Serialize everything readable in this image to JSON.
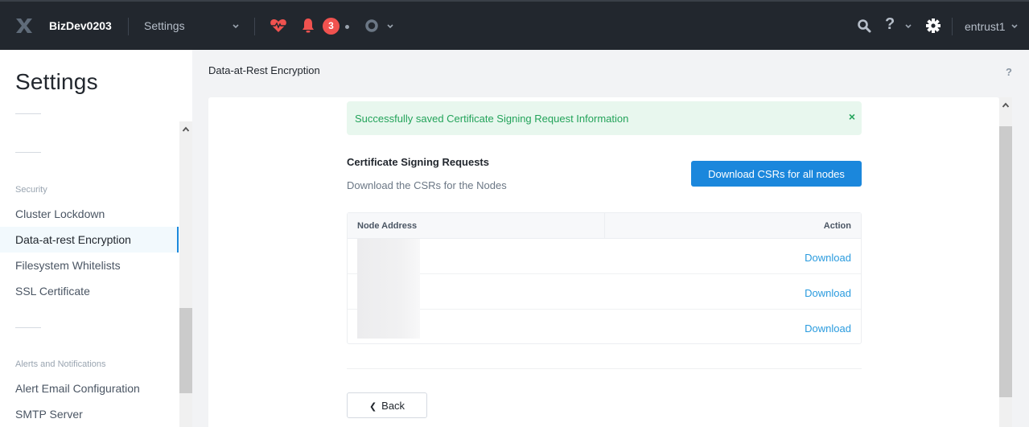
{
  "topbar": {
    "cluster_name": "BizDev0203",
    "app_select": "Settings",
    "alert_count": "3",
    "user_name": "entrust1",
    "icons": [
      "nutanix-logo-icon",
      "chevron-down-icon",
      "health-heart-icon",
      "bell-icon",
      "status-ring-icon",
      "search-icon",
      "help-icon",
      "gear-icon"
    ],
    "colors": {
      "background": "#22272e",
      "alert": "#f0524f"
    }
  },
  "sidebar": {
    "title": "Settings",
    "sections": [
      {
        "label": "Security",
        "items": [
          {
            "label": "Cluster Lockdown",
            "active": false
          },
          {
            "label": "Data-at-rest Encryption",
            "active": true
          },
          {
            "label": "Filesystem Whitelists",
            "active": false
          },
          {
            "label": "SSL Certificate",
            "active": false
          }
        ]
      },
      {
        "label": "Alerts and Notifications",
        "items": [
          {
            "label": "Alert Email Configuration",
            "active": false
          },
          {
            "label": "SMTP Server",
            "active": false
          }
        ]
      }
    ]
  },
  "main": {
    "page_title": "Data-at-Rest Encryption",
    "help_label": "?",
    "alert": {
      "text": "Successfully saved Certificate Signing Request Information",
      "close": "×",
      "color": "#23a35a"
    },
    "section_title": "Certificate Signing Requests",
    "section_desc": "Download the CSRs for the Nodes",
    "download_all_label": "Download CSRs for all nodes",
    "table": {
      "columns": [
        "Node Address",
        "Action"
      ],
      "rows": [
        {
          "address": "",
          "action": "Download"
        },
        {
          "address": "",
          "action": "Download"
        },
        {
          "address": "",
          "action": "Download"
        }
      ]
    },
    "back_label": "Back",
    "accent_color": "#1b87dc"
  }
}
